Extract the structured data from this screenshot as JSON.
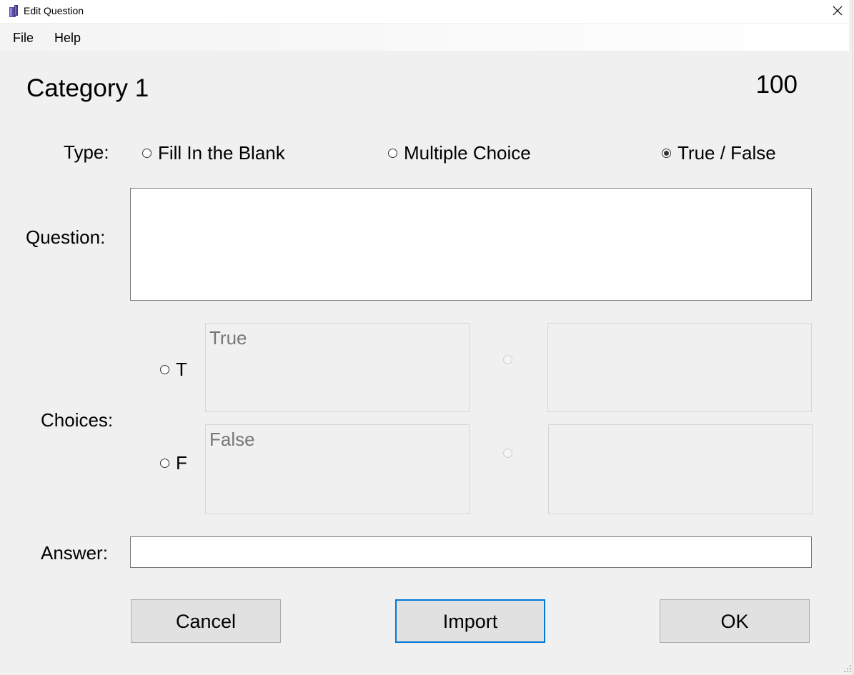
{
  "window": {
    "title": "Edit Question"
  },
  "menu": {
    "items": [
      {
        "label": "File"
      },
      {
        "label": "Help"
      }
    ]
  },
  "header": {
    "category": "Category 1",
    "points": "100"
  },
  "type": {
    "label": "Type:",
    "options": [
      {
        "label": "Fill In the Blank",
        "selected": false
      },
      {
        "label": "Multiple Choice",
        "selected": false
      },
      {
        "label": "True / False",
        "selected": true
      }
    ]
  },
  "question": {
    "label": "Question:",
    "value": ""
  },
  "choices": {
    "label": "Choices:",
    "items": [
      {
        "letter": "T",
        "value": "True",
        "selected": false
      },
      {
        "letter": "F",
        "value": "False",
        "selected": false
      }
    ],
    "extra": [
      {
        "value": ""
      },
      {
        "value": ""
      }
    ]
  },
  "answer": {
    "label": "Answer:",
    "value": ""
  },
  "buttons": {
    "cancel": "Cancel",
    "import": "Import",
    "ok": "OK"
  },
  "colors": {
    "focus_border": "#0078d7",
    "background": "#f0f0f0",
    "button_face": "#e1e1e1"
  },
  "icons": {
    "app": "book-icon",
    "close": "close-icon"
  }
}
